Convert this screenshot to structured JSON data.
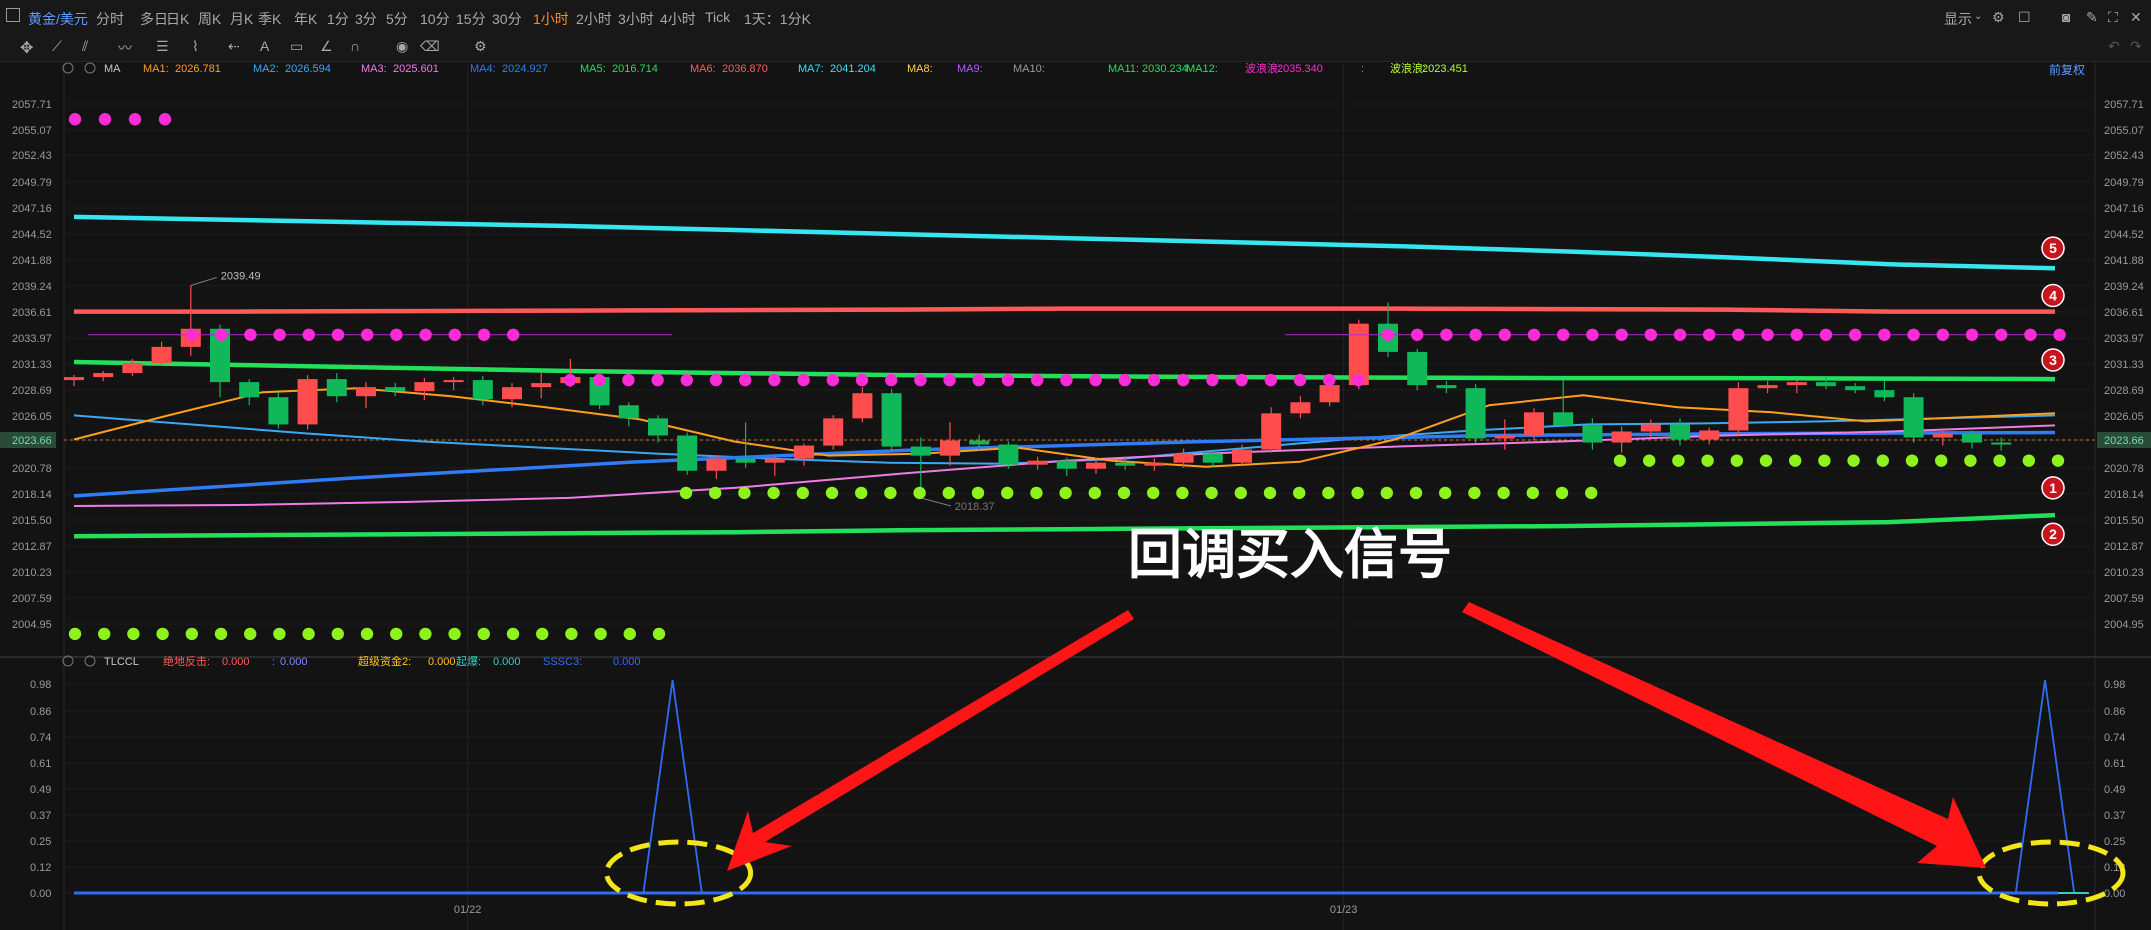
{
  "toolbar": {
    "symbol": "黄金/美元",
    "periods": [
      "分时",
      "多日",
      "日K",
      "周K",
      "月K",
      "季K",
      "年K",
      "1分",
      "3分",
      "5分",
      "10分",
      "15分",
      "30分",
      "1小时",
      "2小时",
      "3小时",
      "4小时",
      "Tick",
      "1天：1分K"
    ],
    "active_period": "1小时",
    "display_label": "显示"
  },
  "main_legend": {
    "name": "MA",
    "items": [
      {
        "label": "MA1:",
        "value": "2026.781",
        "color": "#ff9f1c"
      },
      {
        "label": "MA2:",
        "value": "2026.594",
        "color": "#3aa9f5"
      },
      {
        "label": "MA3:",
        "value": "2025.601",
        "color": "#f07be8"
      },
      {
        "label": "MA4:",
        "value": "2024.927",
        "color": "#2f7cf6"
      },
      {
        "label": "MA5:",
        "value": "2016.714",
        "color": "#22e05a"
      },
      {
        "label": "MA6:",
        "value": "2036.870",
        "color": "#ff5a5a"
      },
      {
        "label": "MA7:",
        "value": "2041.204",
        "color": "#35e6f0"
      },
      {
        "label": "MA8:",
        "value": "",
        "color": "#ffd24a"
      },
      {
        "label": "MA9:",
        "value": "",
        "color": "#b05cff"
      },
      {
        "label": "MA10:",
        "value": "",
        "color": "#9a9a9a"
      },
      {
        "label": "MA11:",
        "value": "2030.234",
        "color": "#22e05a"
      },
      {
        "label": "MA12:",
        "value": "",
        "color": "#22e05a"
      },
      {
        "label": "波浪浪:",
        "value": "2035.340",
        "color": "#ff2bd6"
      },
      {
        "label": ":",
        "value": "",
        "color": "#888888"
      },
      {
        "label": "波浪浪:",
        "value": "2023.451",
        "color": "#b6ff2b"
      }
    ],
    "right_label": "前复权"
  },
  "sub_legend": {
    "name": "TLCCL",
    "items": [
      {
        "label": "绝地反击:",
        "value": "0.000",
        "color": "#ff5a5a"
      },
      {
        "label": ":",
        "value": "0.000",
        "color": "#7a8cff"
      },
      {
        "label": "超级资金2:",
        "value": "0.000",
        "color": "#ffc21c"
      },
      {
        "label": "起爆:",
        "value": "0.000",
        "color": "#2fd0c0"
      },
      {
        "label": "SSSC3:",
        "value": "0.000",
        "color": "#2f6cf6"
      }
    ]
  },
  "annotation_text": "回调买入信号",
  "chart_data": [
    {
      "type": "candlestick",
      "title": "黄金/美元 1小时",
      "y_ticks": [
        "2057.71",
        "2055.07",
        "2052.43",
        "2049.79",
        "2047.16",
        "2044.52",
        "2041.88",
        "2039.24",
        "2036.61",
        "2033.97",
        "2031.33",
        "2028.69",
        "2026.05",
        "2023.66",
        "2020.78",
        "2018.14",
        "2015.50",
        "2012.87",
        "2010.23",
        "2007.59",
        "2004.95"
      ],
      "ylim": [
        2003.5,
        2059.5
      ],
      "current_price": "2023.66",
      "x_labels": [
        "01/22",
        "01/23"
      ],
      "x_label_index": [
        13,
        43
      ],
      "high_label": "2039.49",
      "low_label": "2018.37",
      "candles": [
        [
          2030.1,
          2030.6,
          2029.5,
          2030.4
        ],
        [
          2030.4,
          2031.0,
          2030.0,
          2030.8
        ],
        [
          2030.8,
          2032.2,
          2030.5,
          2031.8
        ],
        [
          2031.8,
          2033.9,
          2031.6,
          2033.4
        ],
        [
          2033.4,
          2039.5,
          2032.5,
          2035.2
        ],
        [
          2035.2,
          2035.6,
          2028.4,
          2029.9
        ],
        [
          2029.9,
          2030.2,
          2027.6,
          2028.4
        ],
        [
          2028.4,
          2028.9,
          2025.3,
          2025.7
        ],
        [
          2025.7,
          2030.6,
          2025.2,
          2030.2
        ],
        [
          2030.2,
          2030.8,
          2027.9,
          2028.5
        ],
        [
          2028.5,
          2029.9,
          2027.3,
          2029.4
        ],
        [
          2029.4,
          2029.8,
          2028.5,
          2029.0
        ],
        [
          2029.0,
          2030.3,
          2028.1,
          2029.9
        ],
        [
          2029.9,
          2030.4,
          2029.1,
          2030.1
        ],
        [
          2030.1,
          2030.5,
          2027.6,
          2028.2
        ],
        [
          2028.2,
          2029.8,
          2027.4,
          2029.4
        ],
        [
          2029.4,
          2030.9,
          2028.3,
          2029.8
        ],
        [
          2029.8,
          2032.2,
          2029.4,
          2030.4
        ],
        [
          2030.4,
          2030.7,
          2027.2,
          2027.6
        ],
        [
          2027.6,
          2027.9,
          2025.5,
          2026.3
        ],
        [
          2026.3,
          2026.6,
          2023.9,
          2024.6
        ],
        [
          2024.6,
          2024.9,
          2020.7,
          2021.1
        ],
        [
          2021.1,
          2022.6,
          2020.3,
          2022.3
        ],
        [
          2022.3,
          2025.9,
          2021.4,
          2021.9
        ],
        [
          2021.9,
          2022.6,
          2020.6,
          2022.3
        ],
        [
          2022.3,
          2023.8,
          2021.6,
          2023.6
        ],
        [
          2023.6,
          2026.6,
          2023.2,
          2026.3
        ],
        [
          2026.3,
          2029.4,
          2025.9,
          2028.8
        ],
        [
          2028.8,
          2029.2,
          2023.0,
          2023.5
        ],
        [
          2023.5,
          2024.4,
          2018.4,
          2022.6
        ],
        [
          2022.6,
          2025.9,
          2021.6,
          2024.1
        ],
        [
          2024.1,
          2024.7,
          2023.1,
          2023.7
        ],
        [
          2023.7,
          2024.0,
          2021.3,
          2021.7
        ],
        [
          2021.7,
          2022.5,
          2021.2,
          2022.1
        ],
        [
          2022.1,
          2022.4,
          2020.6,
          2021.3
        ],
        [
          2021.3,
          2022.4,
          2020.8,
          2021.9
        ],
        [
          2021.9,
          2022.4,
          2021.2,
          2021.6
        ],
        [
          2021.6,
          2022.3,
          2021.1,
          2021.9
        ],
        [
          2021.9,
          2023.3,
          2021.4,
          2022.8
        ],
        [
          2022.8,
          2023.2,
          2021.5,
          2021.9
        ],
        [
          2021.9,
          2023.7,
          2021.7,
          2023.2
        ],
        [
          2023.2,
          2027.4,
          2022.9,
          2026.8
        ],
        [
          2026.8,
          2028.5,
          2026.3,
          2027.9
        ],
        [
          2027.9,
          2030.5,
          2027.5,
          2029.6
        ],
        [
          2029.6,
          2036.1,
          2029.2,
          2035.7
        ],
        [
          2035.7,
          2037.8,
          2032.4,
          2032.9
        ],
        [
          2032.9,
          2033.2,
          2029.1,
          2029.6
        ],
        [
          2029.6,
          2030.0,
          2028.8,
          2029.3
        ],
        [
          2029.3,
          2029.7,
          2023.8,
          2024.3
        ],
        [
          2024.3,
          2026.2,
          2023.2,
          2024.6
        ],
        [
          2024.6,
          2027.3,
          2024.1,
          2026.9
        ],
        [
          2026.9,
          2030.1,
          2026.0,
          2025.6
        ],
        [
          2025.6,
          2026.3,
          2023.2,
          2023.9
        ],
        [
          2023.9,
          2025.5,
          2022.9,
          2025.0
        ],
        [
          2025.0,
          2026.2,
          2024.4,
          2025.7
        ],
        [
          2025.7,
          2026.3,
          2023.6,
          2024.2
        ],
        [
          2024.2,
          2025.4,
          2023.7,
          2025.1
        ],
        [
          2025.1,
          2029.9,
          2024.6,
          2029.3
        ],
        [
          2029.3,
          2030.0,
          2028.8,
          2029.6
        ],
        [
          2029.6,
          2030.1,
          2028.8,
          2029.9
        ],
        [
          2029.9,
          2030.4,
          2029.2,
          2029.5
        ],
        [
          2029.5,
          2029.8,
          2028.8,
          2029.1
        ],
        [
          2029.1,
          2030.0,
          2028.0,
          2028.4
        ],
        [
          2028.4,
          2028.8,
          2023.9,
          2024.4
        ],
        [
          2024.4,
          2025.2,
          2023.6,
          2024.8
        ],
        [
          2024.8,
          2025.1,
          2023.3,
          2023.9
        ],
        [
          2023.9,
          2024.4,
          2023.1,
          2023.7
        ]
      ],
      "ma_lines": [
        {
          "name": "MA7",
          "color": "#35e6f0",
          "values": [
            2046.3,
            2046.0,
            2045.7,
            2045.4,
            2045.0,
            2044.6,
            2044.2,
            2043.8,
            2043.4,
            2042.9,
            2042.3,
            2041.6,
            2041.2
          ]
        },
        {
          "name": "MA6",
          "color": "#ff5a5a",
          "values": [
            2036.9,
            2036.9,
            2036.95,
            2037.0,
            2037.05,
            2037.1,
            2037.2,
            2037.2,
            2037.2,
            2037.15,
            2037.1,
            2036.9,
            2036.9
          ]
        },
        {
          "name": "MA11",
          "color": "#22e05a",
          "values": [
            2031.9,
            2031.6,
            2031.3,
            2031.0,
            2030.8,
            2030.6,
            2030.5,
            2030.4,
            2030.35,
            2030.3,
            2030.3,
            2030.25,
            2030.2
          ]
        },
        {
          "name": "MA5",
          "color": "#22e05a",
          "values": [
            2014.6,
            2014.7,
            2014.8,
            2014.9,
            2015.0,
            2015.2,
            2015.3,
            2015.4,
            2015.5,
            2015.6,
            2015.8,
            2016.0,
            2016.7
          ]
        },
        {
          "name": "MA2",
          "color": "#3aa9f5",
          "values": [
            2026.6,
            2025.7,
            2024.8,
            2024.0,
            2023.4,
            2022.8,
            2022.3,
            2021.9,
            2021.8,
            2022.3,
            2023.3,
            2024.3,
            2025.1,
            2025.7,
            2025.8,
            2026.0,
            2026.3,
            2026.6
          ]
        },
        {
          "name": "MA4",
          "color": "#2f7cf6",
          "values": [
            2018.6,
            2020.4,
            2022.0,
            2023.2,
            2024.0,
            2024.6,
            2024.8,
            2024.9
          ]
        },
        {
          "name": "MA3",
          "color": "#f07be8",
          "values": [
            2017.6,
            2017.7,
            2018.0,
            2018.4,
            2019.4,
            2020.8,
            2022.1,
            2022.9,
            2023.5,
            2024.0,
            2024.6,
            2025.0,
            2025.6
          ]
        },
        {
          "name": "MA1",
          "color": "#ff9f1c",
          "values": [
            2024.2,
            2026.6,
            2028.9,
            2029.3,
            2028.5,
            2027.4,
            2026.2,
            2024.0,
            2022.6,
            2022.8,
            2023.4,
            2022.1,
            2021.5,
            2022.0,
            2024.2,
            2027.6,
            2028.6,
            2027.4,
            2026.9,
            2026.0,
            2026.4,
            2026.8
          ]
        }
      ],
      "magenta_dot_levels": [
        2056.0,
        2034.6,
        2030.1
      ],
      "green_dot_levels": [
        2018.9,
        2020.0,
        2022.1,
        2004.9
      ],
      "numbered_markers": [
        "5",
        "4",
        "3",
        "1",
        "2"
      ],
      "numbered_marker_values": [
        2043.2,
        2038.5,
        2032.1,
        2019.4,
        2014.8
      ]
    },
    {
      "type": "line",
      "title": "TLCCL",
      "y_ticks": [
        "0.98",
        "0.86",
        "0.74",
        "0.61",
        "0.49",
        "0.37",
        "0.25",
        "0.12",
        "0.00"
      ],
      "ylim": [
        0,
        0.98
      ],
      "x_labels": [
        "01/22",
        "01/23"
      ],
      "series": [
        {
          "name": "SSSC3",
          "color": "#2f6cf6",
          "x": [
            0,
            19.5,
            20.5,
            21.5,
            66.5,
            67.5,
            68.5,
            69
          ],
          "values": [
            0,
            0,
            0.98,
            0,
            0,
            0.98,
            0,
            0
          ]
        },
        {
          "name": "起爆",
          "color": "#2fd0c0",
          "x": [
            0,
            69
          ],
          "values": [
            0,
            0
          ]
        }
      ],
      "highlight_positions": [
        20.5,
        67.5
      ]
    }
  ]
}
